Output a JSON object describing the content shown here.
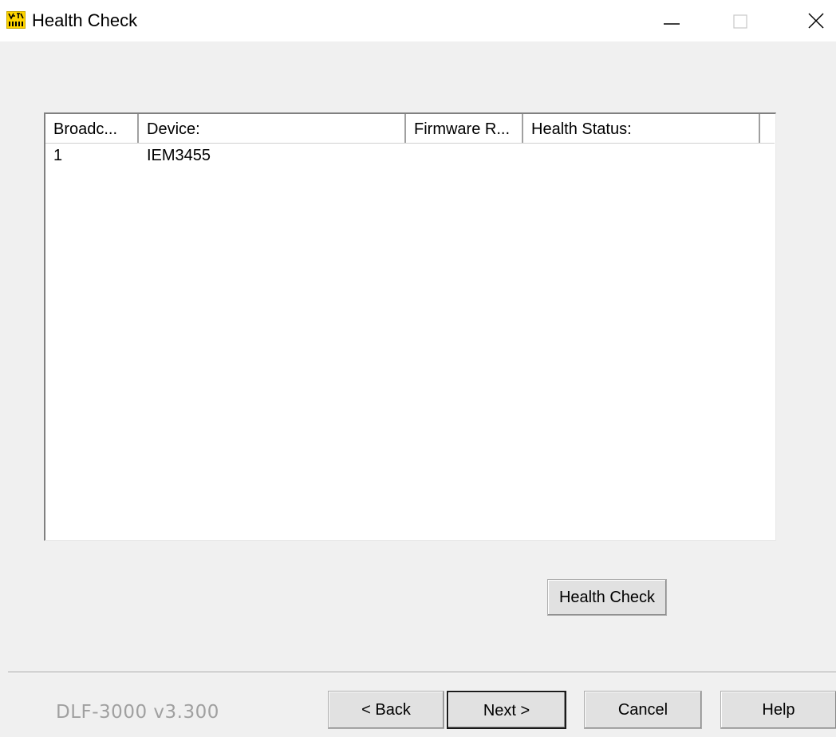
{
  "window": {
    "title": "Health Check",
    "icon": "app-logo-icon",
    "controls": {
      "minimize_icon": "minimize-icon",
      "maximize_icon": "maximize-icon",
      "close_icon": "close-icon"
    }
  },
  "device_list": {
    "columns": [
      "Broadc...",
      "Device:",
      "Firmware R...",
      "Health Status:"
    ],
    "rows": [
      {
        "broadcast": "1",
        "device": "IEM3455",
        "firmware": "",
        "health_status": ""
      }
    ]
  },
  "buttons": {
    "health_check": "Health Check",
    "back": "< Back",
    "next": "Next >",
    "cancel": "Cancel",
    "help": "Help"
  },
  "footer": {
    "version": "DLF-3000 v3.300"
  },
  "colors": {
    "icon_yellow": "#ffd400",
    "version_text": "#a0a0a0",
    "background": "#f0f0f0"
  }
}
